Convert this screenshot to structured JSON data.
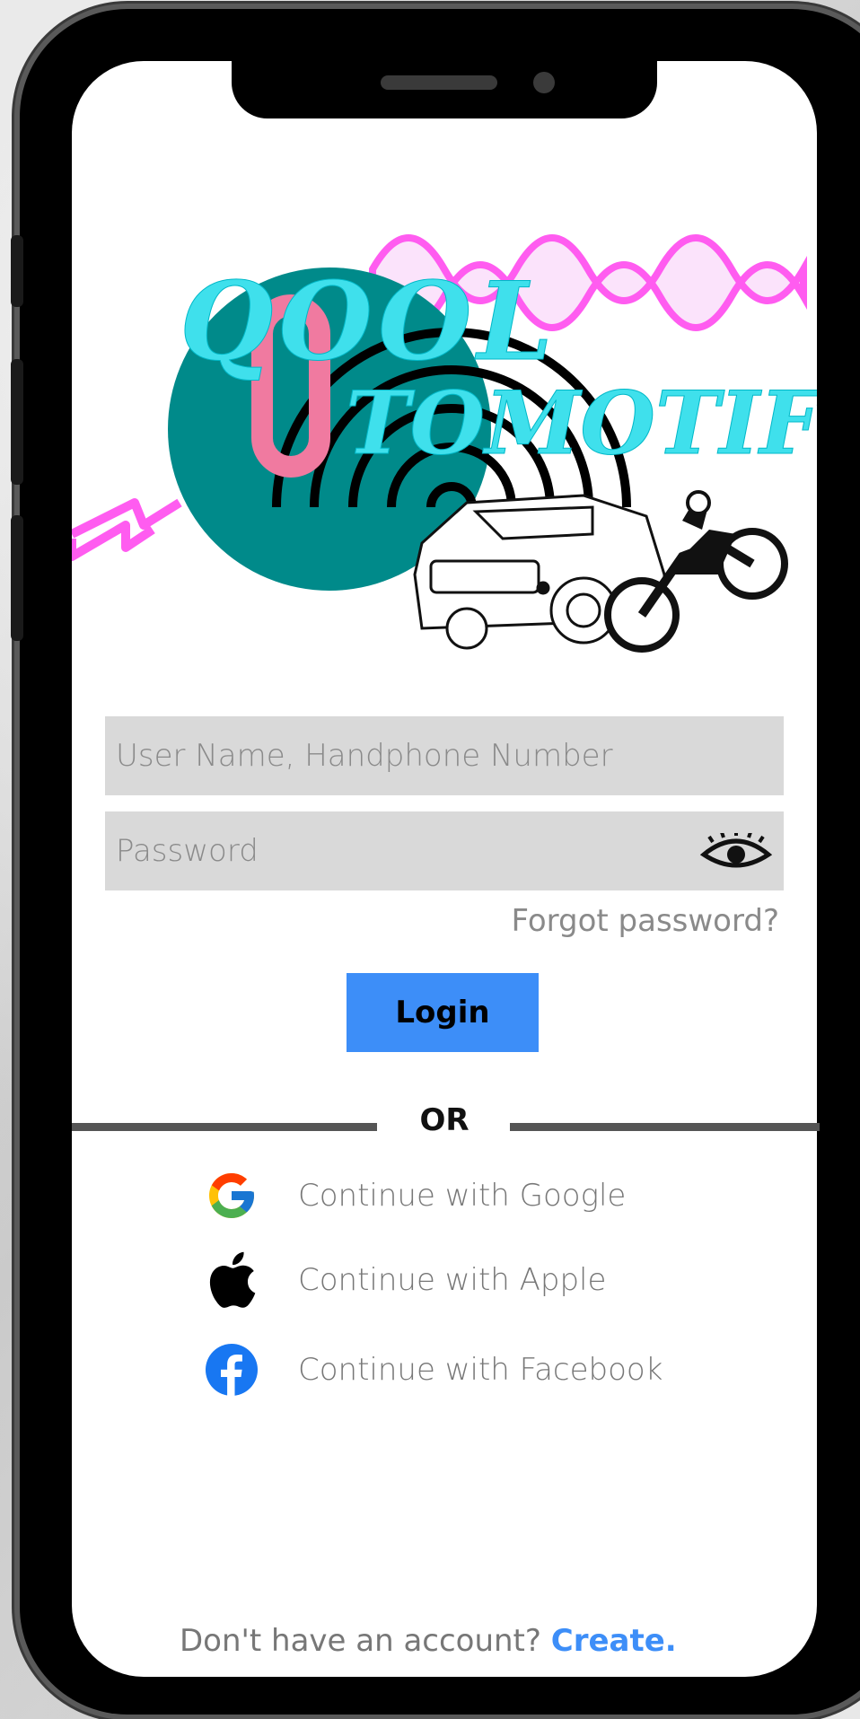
{
  "logo": {
    "line1": "QOOL",
    "line2": "TOMOTIF",
    "brand_colors": {
      "teal": "#008a8a",
      "cyan": "#3fe0ec",
      "pink": "#f07aa0",
      "magenta": "#ff5cf0"
    }
  },
  "form": {
    "username_placeholder": "User Name, Handphone Number",
    "password_placeholder": "Password",
    "forgot_label": "Forgot password?",
    "login_label": "Login"
  },
  "divider": {
    "or_label": "OR"
  },
  "social": {
    "google_label": "Continue with Google",
    "apple_label": "Continue with Apple",
    "facebook_label": "Continue with Facebook"
  },
  "footer": {
    "prompt": "Don't have an account?",
    "create_label": "Create."
  },
  "colors": {
    "accent": "#3d8ef8",
    "field_bg": "#d9d9d9",
    "phone_frame": "#000000"
  },
  "icons": [
    "eye-icon",
    "google-icon",
    "apple-icon",
    "facebook-icon"
  ]
}
